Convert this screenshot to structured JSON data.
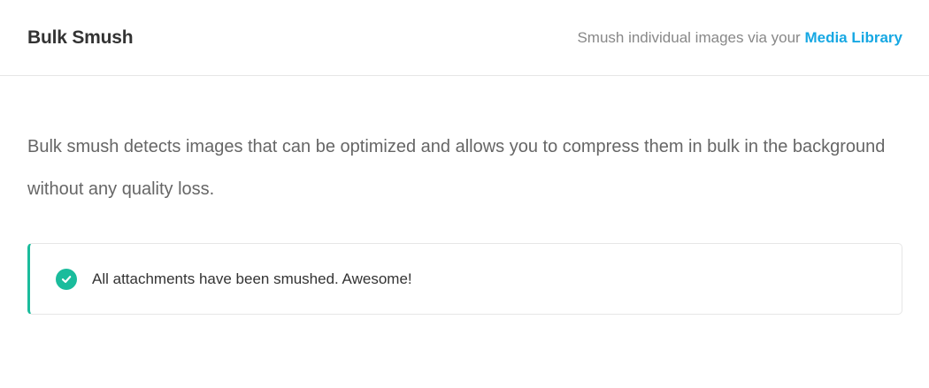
{
  "header": {
    "title": "Bulk Smush",
    "info_prefix": "Smush individual images via your ",
    "info_link": "Media Library"
  },
  "main": {
    "description": "Bulk smush detects images that can be optimized and allows you to compress them in bulk in the background without any quality loss.",
    "notice": {
      "message": "All attachments have been smushed. Awesome!",
      "icon": "check-circle-icon",
      "accent_color": "#1abc9c"
    }
  },
  "colors": {
    "link": "#17a8e3",
    "success": "#1abc9c"
  }
}
